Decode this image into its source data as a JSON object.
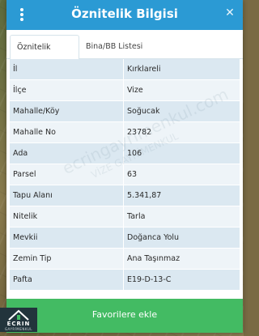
{
  "header": {
    "title": "Öznitelik Bilgisi",
    "menu_icon": "kebab-menu-icon",
    "close_icon": "close-icon",
    "color": "#2b9ad4"
  },
  "tabs": [
    {
      "label": "Öznitelik Bilgisi",
      "active": true
    },
    {
      "label": "Bina/BB Listesi",
      "active": false
    }
  ],
  "rows": [
    {
      "key": "İl",
      "value": "Kırklareli"
    },
    {
      "key": "İlçe",
      "value": "Vize"
    },
    {
      "key": "Mahalle/Köy",
      "value": "Soğucak"
    },
    {
      "key": "Mahalle No",
      "value": "23782"
    },
    {
      "key": "Ada",
      "value": "106"
    },
    {
      "key": "Parsel",
      "value": "63"
    },
    {
      "key": "Tapu Alanı",
      "value": "5.341,87"
    },
    {
      "key": "Nitelik",
      "value": "Tarla"
    },
    {
      "key": "Mevkii",
      "value": "Doğanca Yolu"
    },
    {
      "key": "Zemin Tip",
      "value": "Ana Taşınmaz"
    },
    {
      "key": "Pafta",
      "value": "E19-D-13-C"
    }
  ],
  "footer": {
    "favorite_label": "Favorilere ekle",
    "color": "#43bb63"
  },
  "logo": {
    "name": "ECRIN",
    "tagline": "GAYRİMENKUL"
  },
  "watermark": {
    "line1": "ecringayrimenkul.com",
    "line2": "VİZE GAYRİMENKUL"
  }
}
